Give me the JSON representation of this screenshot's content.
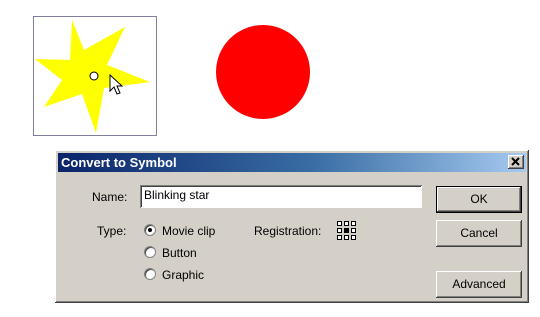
{
  "dialog": {
    "title": "Convert to Symbol",
    "name_label": "Name:",
    "name_value": "Blinking star",
    "type_label": "Type:",
    "type_options": [
      "Movie clip",
      "Button",
      "Graphic"
    ],
    "selected_type": "Movie clip",
    "registration_label": "Registration:",
    "close_label": "✕",
    "buttons": {
      "ok": "OK",
      "cancel": "Cancel",
      "advanced": "Advanced"
    }
  },
  "colors": {
    "star": "#ffff00",
    "circle": "#ff0000",
    "title_gradient_start": "#0a246a",
    "dialog_bg": "#d4d0c8"
  }
}
